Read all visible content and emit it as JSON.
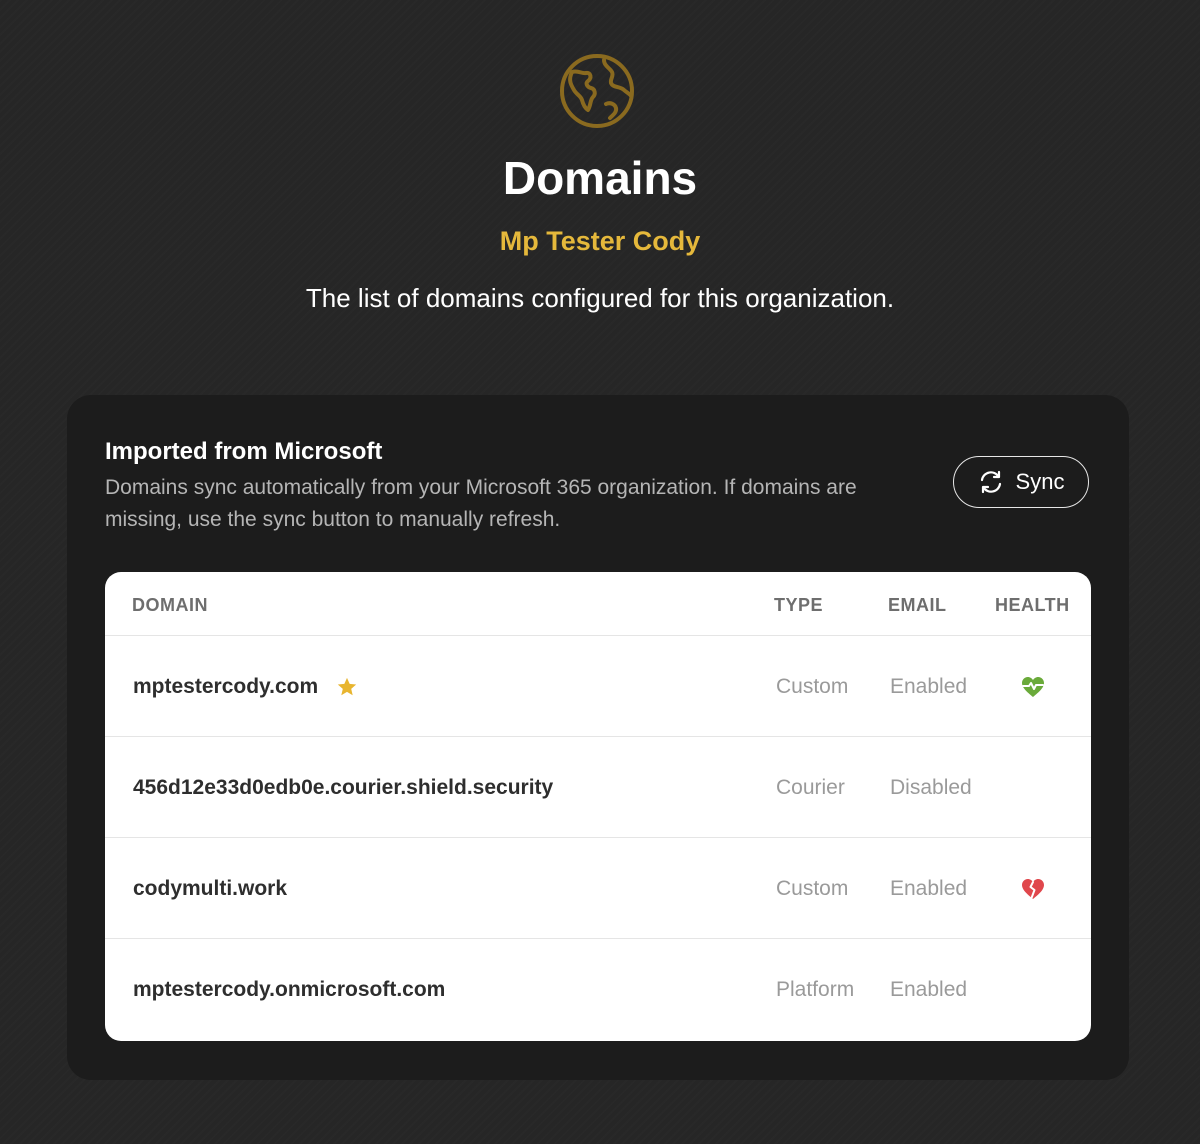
{
  "header": {
    "title": "Domains",
    "organization": "Mp Tester Cody",
    "description": "The list of domains configured for this organization.",
    "icon": "globe-icon"
  },
  "panel": {
    "title": "Imported from Microsoft",
    "description": "Domains sync automatically from your Microsoft 365 organization. If domains are missing, use the sync button to manually refresh.",
    "sync_label": "Sync"
  },
  "table": {
    "columns": [
      "DOMAIN",
      "TYPE",
      "EMAIL",
      "HEALTH"
    ],
    "rows": [
      {
        "domain": "mptestercody.com",
        "type": "Custom",
        "email": "Enabled",
        "primary": true,
        "health": "healthy"
      },
      {
        "domain": "456d12e33d0edb0e.courier.shield.security",
        "type": "Courier",
        "email": "Disabled",
        "primary": false,
        "health": "none"
      },
      {
        "domain": "codymulti.work",
        "type": "Custom",
        "email": "Enabled",
        "primary": false,
        "health": "unhealthy"
      },
      {
        "domain": "mptestercody.onmicrosoft.com",
        "type": "Platform",
        "email": "Enabled",
        "primary": false,
        "health": "none"
      }
    ]
  },
  "colors": {
    "background": "#262626",
    "panel": "#1c1c1c",
    "accent_gold": "#e5b83b",
    "globe_gold": "#8a6a1f",
    "healthy_green": "#6aaa3a",
    "unhealthy_red": "#e0474c",
    "star": "#e8b52f"
  }
}
